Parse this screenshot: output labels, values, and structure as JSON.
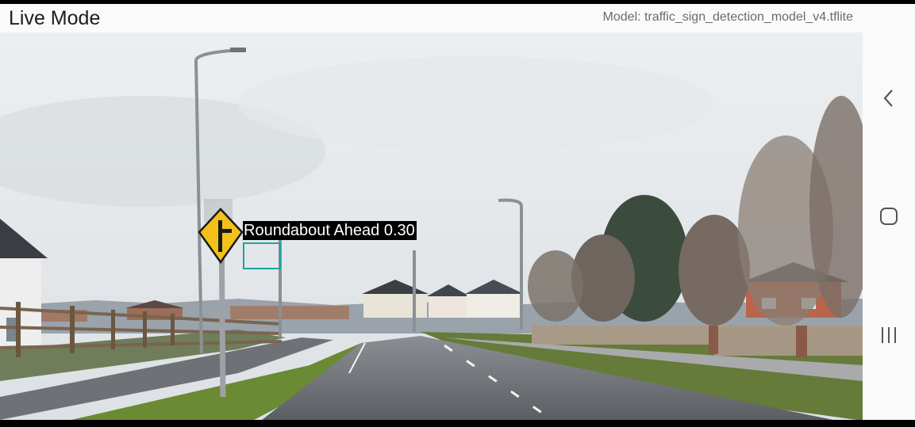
{
  "app": {
    "title": "Live Mode",
    "model_label": "Model: traffic_sign_detection_model_v4.tflite"
  },
  "detection": {
    "label": "Roundabout Ahead 0.30",
    "box_color": "#1aa5a5"
  },
  "camera": {
    "description_icon": "camera-feed"
  },
  "nav": {
    "back_icon": "chevron-left-icon",
    "home_icon": "rounded-square-icon",
    "recents_icon": "three-bars-icon"
  }
}
